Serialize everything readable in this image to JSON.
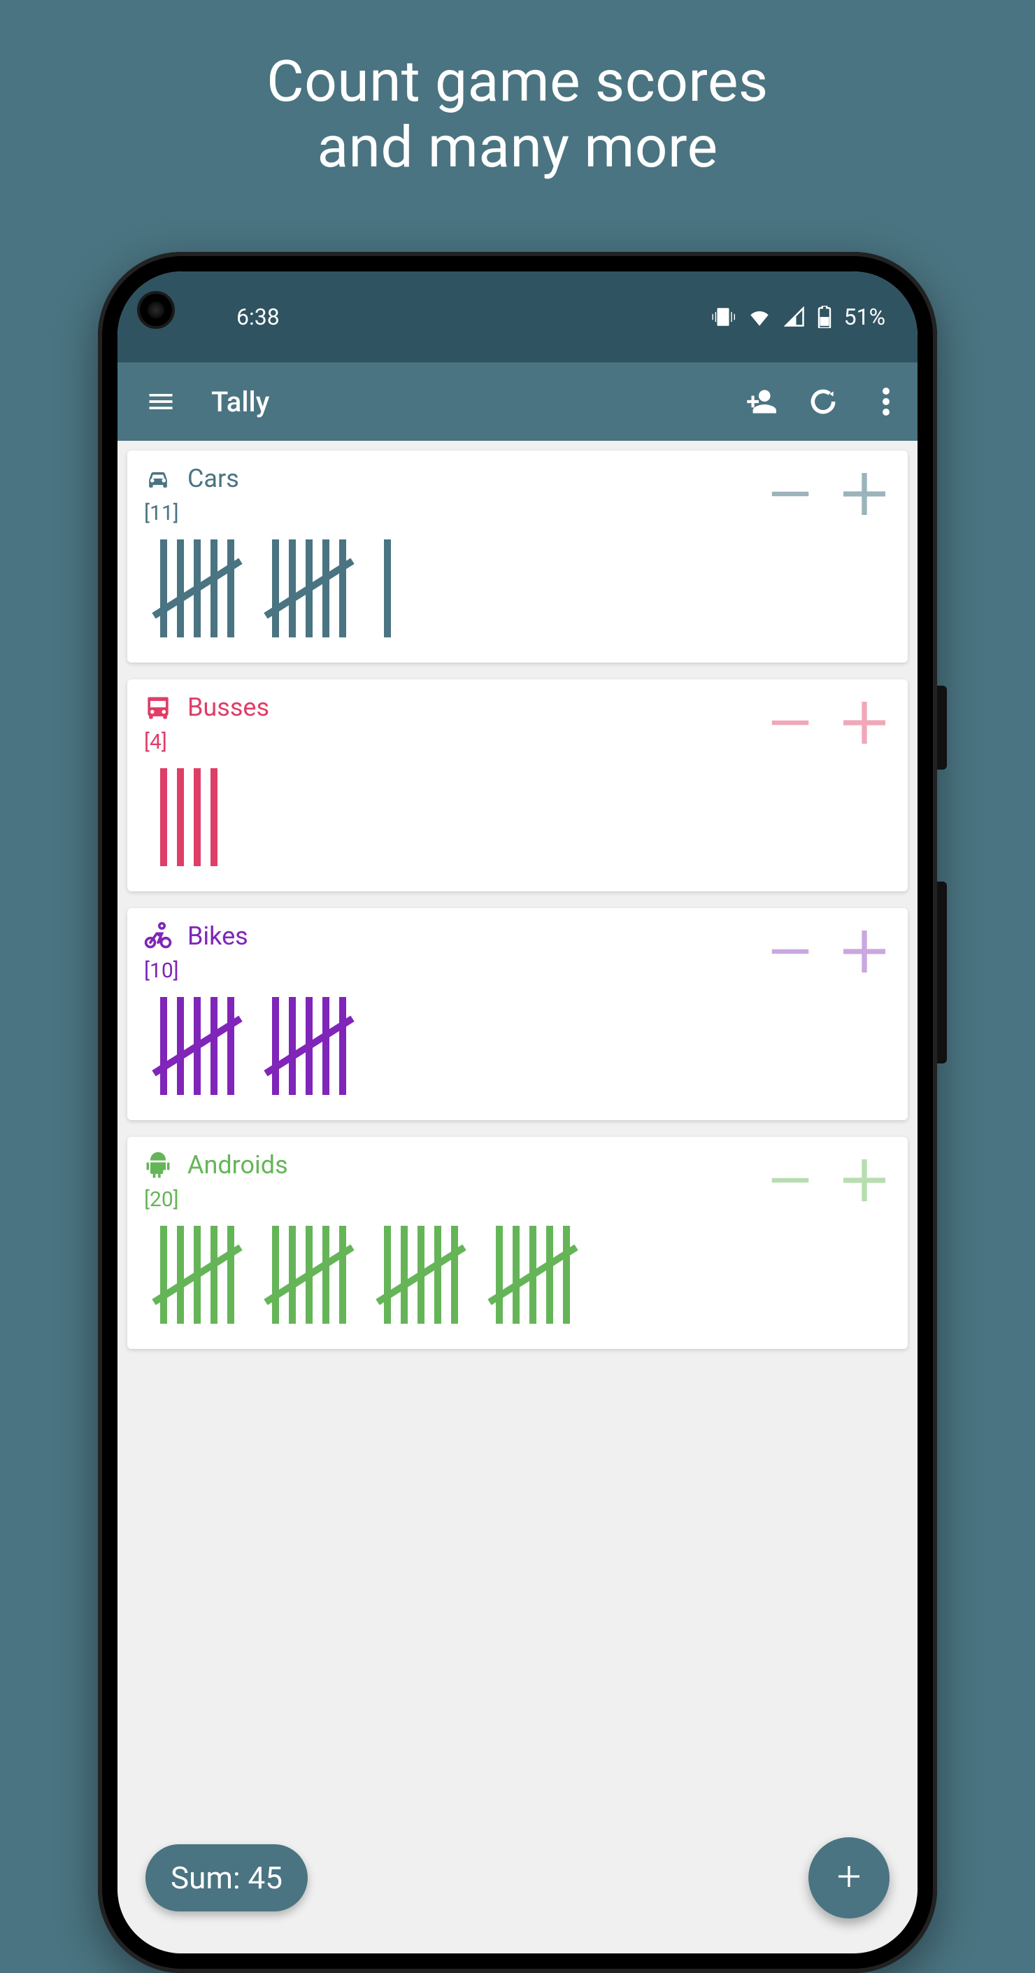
{
  "promo": {
    "line1": "Count game scores",
    "line2": "and many more"
  },
  "statusbar": {
    "time": "6:38",
    "battery_label": "51%"
  },
  "actionbar": {
    "title": "Tally"
  },
  "counters": [
    {
      "id": "cars",
      "label": "Cars",
      "count": 11,
      "count_display": "[11]",
      "color": "#4a7481",
      "control_color": "#7a9aa5",
      "icon": "car"
    },
    {
      "id": "busses",
      "label": "Busses",
      "count": 4,
      "count_display": "[4]",
      "color": "#df3e67",
      "control_color": "#ec8ba2",
      "icon": "bus"
    },
    {
      "id": "bikes",
      "label": "Bikes",
      "count": 10,
      "count_display": "[10]",
      "color": "#8025b9",
      "control_color": "#b98ad6",
      "icon": "bike"
    },
    {
      "id": "androids",
      "label": "Androids",
      "count": 20,
      "count_display": "[20]",
      "color": "#65b558",
      "control_color": "#a0d298",
      "icon": "android"
    }
  ],
  "sum": {
    "label": "Sum: 45",
    "value": 45
  }
}
